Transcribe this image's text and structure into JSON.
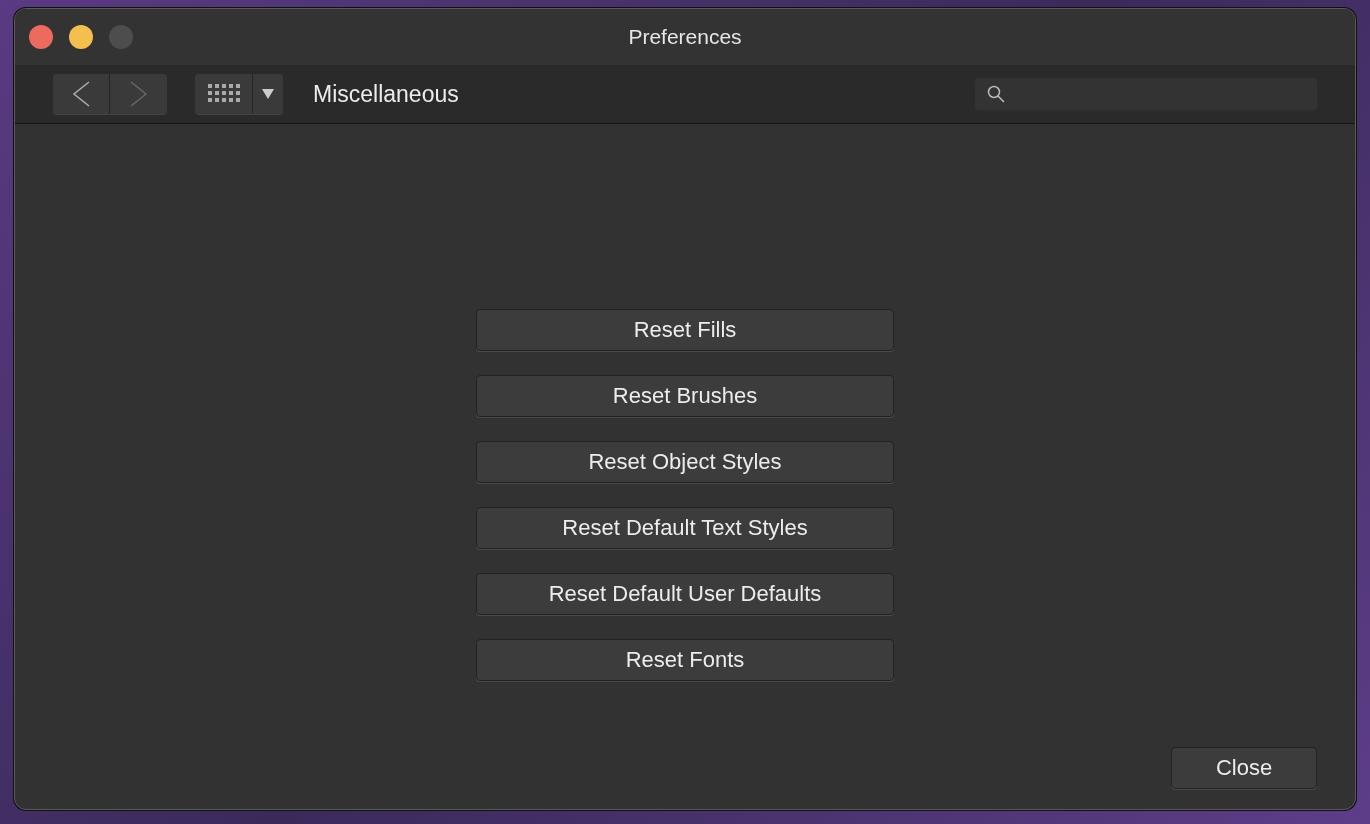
{
  "window": {
    "title": "Preferences"
  },
  "toolbar": {
    "nav": [
      {
        "kind": "back",
        "disabled": false
      },
      {
        "kind": "forward",
        "disabled": true
      }
    ],
    "section": "Miscellaneous"
  },
  "buttons": [
    {
      "label": "Reset Fills"
    },
    {
      "label": "Reset Brushes"
    },
    {
      "label": "Reset Object Styles"
    },
    {
      "label": "Reset Default Text Styles"
    },
    {
      "label": "Reset Default User Defaults"
    },
    {
      "label": "Reset Fonts"
    }
  ],
  "footer": {
    "close": "Close"
  }
}
